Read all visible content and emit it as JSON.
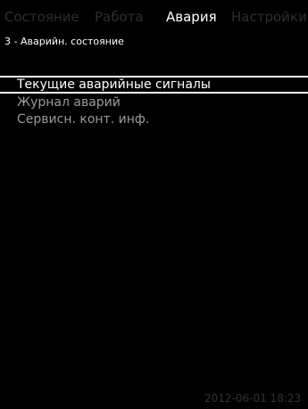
{
  "tabs": [
    {
      "label": "Состояние",
      "active": false
    },
    {
      "label": "Работа",
      "active": false
    },
    {
      "label": "Авария",
      "active": true
    },
    {
      "label": "Настройки",
      "active": false
    }
  ],
  "breadcrumb": "3 - Аварийн. состояние",
  "menu": {
    "items": [
      {
        "label": "Текущие аварийные сигналы",
        "selected": true
      },
      {
        "label": "Журнал аварий",
        "selected": false
      },
      {
        "label": "Сервисн. конт. инф.",
        "selected": false
      }
    ]
  },
  "status": {
    "datetime": "2012-06-01 18:23"
  },
  "colors": {
    "background": "#000000",
    "active_text": "#ffffff",
    "inactive_tab": "#2e2e2e",
    "menu_text": "#9a9a9a",
    "clock_text": "#333333"
  }
}
